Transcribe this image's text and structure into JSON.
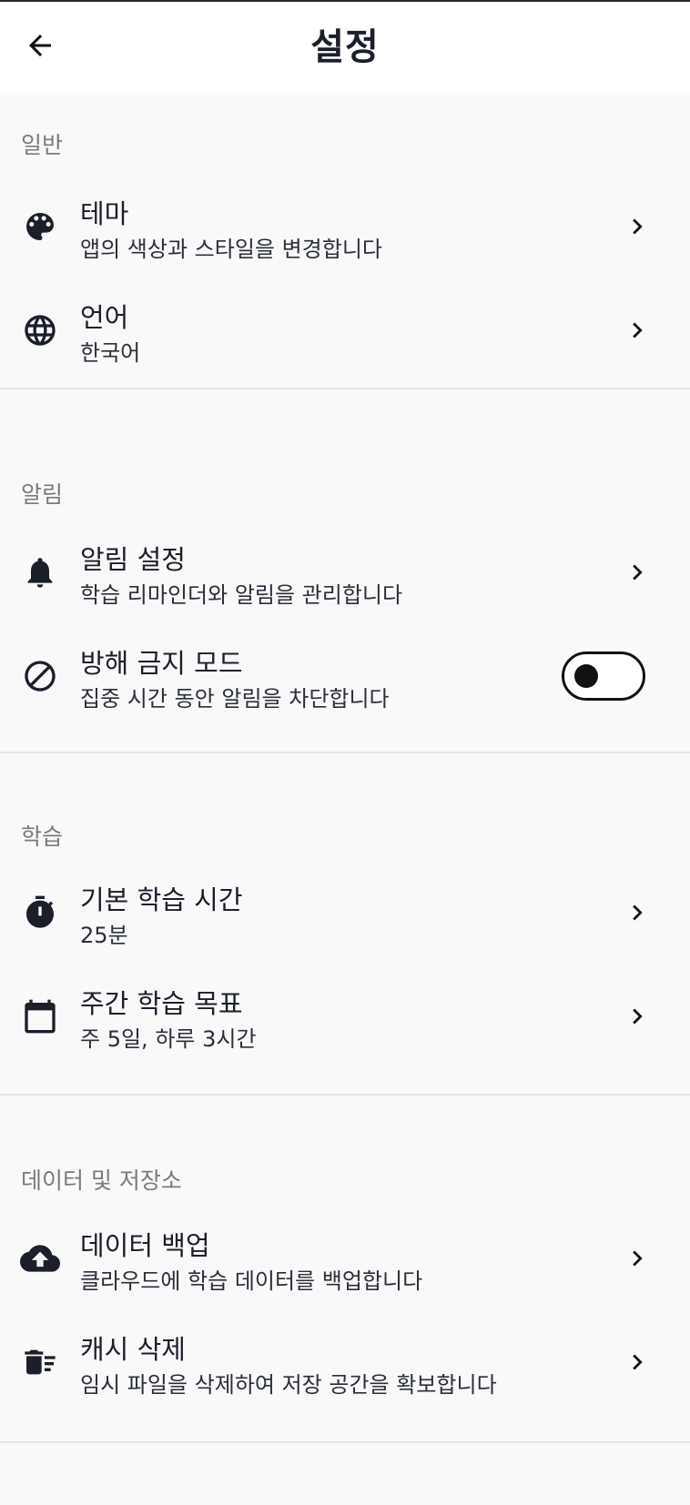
{
  "header": {
    "back_icon": "arrow-back-icon",
    "title": "설정"
  },
  "sections": [
    {
      "title": "일반",
      "items": [
        {
          "icon": "palette-icon",
          "title": "테마",
          "subtitle": "앱의 색상과 스타일을 변경합니다",
          "control": "chevron"
        },
        {
          "icon": "globe-icon",
          "title": "언어",
          "subtitle": "한국어",
          "control": "chevron"
        }
      ]
    },
    {
      "title": "알림",
      "items": [
        {
          "icon": "bell-icon",
          "title": "알림 설정",
          "subtitle": "학습 리마인더와 알림을 관리합니다",
          "control": "chevron"
        },
        {
          "icon": "do-not-disturb-icon",
          "title": "방해 금지 모드",
          "subtitle": "집중 시간 동안 알림을 차단합니다",
          "control": "toggle",
          "toggle_on": false
        }
      ]
    },
    {
      "title": "학습",
      "items": [
        {
          "icon": "timer-icon",
          "title": "기본 학습 시간",
          "subtitle": "25분",
          "control": "chevron"
        },
        {
          "icon": "calendar-icon",
          "title": "주간 학습 목표",
          "subtitle": "주 5일, 하루 3시간",
          "control": "chevron"
        }
      ]
    },
    {
      "title": "데이터 및 저장소",
      "items": [
        {
          "icon": "cloud-upload-icon",
          "title": "데이터 백업",
          "subtitle": "클라우드에 학습 데이터를 백업합니다",
          "control": "chevron"
        },
        {
          "icon": "delete-sweep-icon",
          "title": "캐시 삭제",
          "subtitle": "임시 파일을 삭제하여 저장 공간을 확보합니다",
          "control": "chevron"
        }
      ]
    }
  ],
  "colors": {
    "background": "#f9f9f9",
    "header_background": "#ffffff",
    "text_primary": "#1b1f2a",
    "section_title": "#7b7b7b",
    "divider": "#e4e4e4"
  }
}
